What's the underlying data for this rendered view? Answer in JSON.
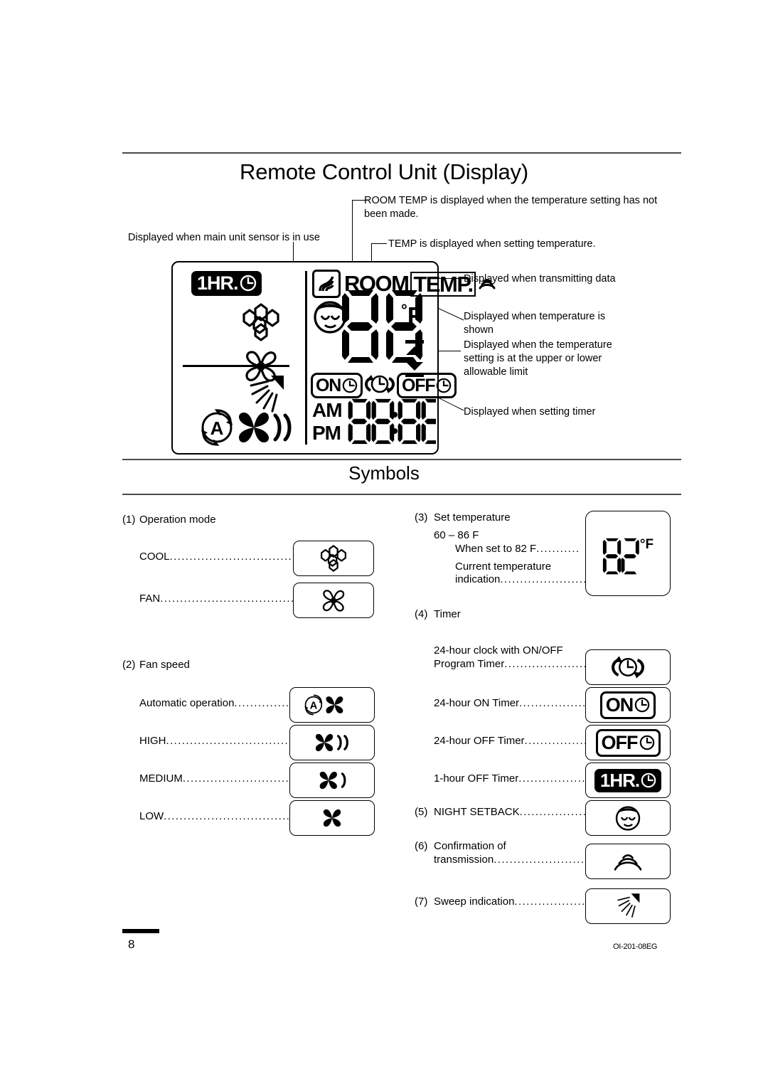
{
  "page": {
    "title": "Remote Control Unit (Display)",
    "section_title": "Symbols",
    "footer_page_number": "8",
    "footer_code": "OI-201-08EG"
  },
  "callouts": {
    "room_temp": "ROOM TEMP  is displayed when the temperature setting has not been made.",
    "main_unit_sensor": "Displayed when main unit sensor is in use",
    "temp_setting": "TEMP  is displayed when setting temperature.",
    "transmitting": "Displayed when transmitting data",
    "temperature_shown": "Displayed when temperature is shown",
    "limit": "Displayed when the temperature setting is at the upper or lower allowable limit",
    "setting_timer": "Displayed when setting timer"
  },
  "lcd": {
    "badge_1hr": "1HR.",
    "room_label": "ROOM",
    "temp_label": "TEMP.",
    "deg_f": "F",
    "deg_symbol": "°",
    "on_label": "ON",
    "off_label": "OFF",
    "am_label": "AM",
    "pm_label": "PM",
    "temperature_digits": "88",
    "clock_digits": "88:88",
    "icons": {
      "sensor": "main-unit-sensor-icon",
      "night_setback": "night-setback-face-icon",
      "snowflake": "cool-snowflake-icon",
      "fan": "fan-outline-icon",
      "sweep": "sweep-indication-icon",
      "auto_fan": "auto-fan-speed-icon",
      "transmit": "transmission-wave-icon",
      "limit_arrows": "upper-lower-limit-arrows-icon",
      "clock": "clock-icon",
      "program_timer": "program-timer-icon"
    }
  },
  "symbols": {
    "groups": [
      {
        "number": "(1)",
        "title": "Operation mode",
        "items": [
          {
            "label": "COOL",
            "dots": "........................................",
            "icon": "cool-snowflake-icon"
          },
          {
            "label": "FAN",
            "dots": "..........................................",
            "icon": "fan-outline-icon"
          }
        ]
      },
      {
        "number": "(2)",
        "title": "Fan speed",
        "items": [
          {
            "label": "Automatic operation",
            "dots": "..............",
            "icon": "auto-fan-speed-icon"
          },
          {
            "label": "HIGH",
            "dots": "........................................",
            "icon": "fan-high-icon"
          },
          {
            "label": "MEDIUM",
            "dots": "................................",
            "icon": "fan-medium-icon"
          },
          {
            "label": "LOW",
            "dots": "........................................",
            "icon": "fan-low-icon"
          }
        ]
      },
      {
        "number": "(3)",
        "title": "Set temperature",
        "range": "60 – 86  F",
        "items": [
          {
            "label": "When set to 82  F",
            "dots": "...........",
            "icon": "seven-segment-82-f"
          },
          {
            "label": "Current temperature indication",
            "dots": "........................",
            "icon": "seven-segment-82-f"
          }
        ]
      },
      {
        "number": "(4)",
        "title": "Timer",
        "items": [
          {
            "label": "24-hour clock with ON/OFF Program Timer",
            "dots": ".....................",
            "icon": "program-timer-icon"
          },
          {
            "label": "24-hour ON Timer",
            "dots": "..................",
            "icon": "on-timer-icon"
          },
          {
            "label": "24-hour OFF Timer",
            "dots": "................",
            "icon": "off-timer-icon"
          },
          {
            "label": "1-hour OFF Timer",
            "dots": "..................",
            "icon": "one-hour-off-timer-icon"
          }
        ]
      },
      {
        "number": "(5)",
        "title": "NIGHT SETBACK",
        "dots": "...................",
        "icon": "night-setback-face-icon"
      },
      {
        "number": "(6)",
        "title": "Confirmation of transmission",
        "dots": "..........................",
        "icon": "transmission-wave-icon"
      },
      {
        "number": "(7)",
        "title": "Sweep indication",
        "dots": "...................",
        "icon": "sweep-indication-icon"
      }
    ],
    "set_temp_box_value": "82",
    "set_temp_box_unit": "°F",
    "on_timer_text": "ON",
    "off_timer_text": "OFF",
    "one_hour_text": "1HR."
  }
}
